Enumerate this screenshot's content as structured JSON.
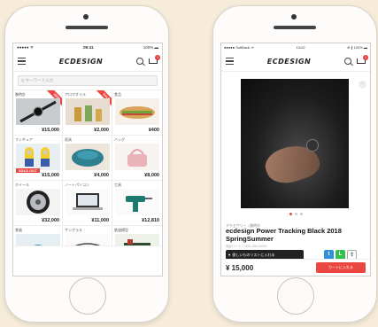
{
  "phone_a": {
    "status": {
      "carrier": "●●●●● ᯤ",
      "time": "09:41",
      "battery": "100% ▬"
    },
    "logo": "ECDESIGN",
    "cart_count": "1",
    "search_placeholder": "Q キーワード入力",
    "products": [
      {
        "category": "腕時計",
        "price": "¥15,000",
        "badge": "NEW"
      },
      {
        "category": "アロマオイル",
        "price": "¥2,000",
        "badge": "SALE"
      },
      {
        "category": "食品",
        "price": "¥400",
        "badge": ""
      },
      {
        "category": "フィギュア",
        "price": "¥15,000",
        "badge": "",
        "status": "SOLD OUT"
      },
      {
        "category": "家具",
        "price": "¥4,000",
        "badge": ""
      },
      {
        "category": "バッグ",
        "price": "¥8,000",
        "badge": ""
      },
      {
        "category": "ホイール",
        "price": "¥32,000",
        "badge": ""
      },
      {
        "category": "ノートパソコン",
        "price": "¥11,000",
        "badge": ""
      },
      {
        "category": "工具",
        "price": "¥12,810",
        "badge": ""
      },
      {
        "category": "食器",
        "price": "",
        "badge": ""
      },
      {
        "category": "サングラス",
        "price": "",
        "badge": ""
      },
      {
        "category": "鉄道模型",
        "price": "",
        "badge": ""
      }
    ]
  },
  "phone_b": {
    "status": {
      "carrier": "●●●●● SoftBank ᯤ",
      "time": "13:02",
      "battery": "⊕ ∦ 100% ▬"
    },
    "logo": "ECDESIGN",
    "cart_count": "1",
    "category_label": "アクセサリー / 腕時計",
    "title": "ecdesign Power Tracking Black 2018 SpringSummer",
    "sub_info": "商品コード：0011-000-00000",
    "wish_label": "欲しいものリストに入れる",
    "price": "¥ 15,000",
    "add_to_cart": "カートに入れる",
    "share": {
      "twitter": "t",
      "line": "L",
      "other": "⇪"
    }
  },
  "colors": {
    "accent": "#e9473f",
    "background": "#f6ecd9"
  }
}
